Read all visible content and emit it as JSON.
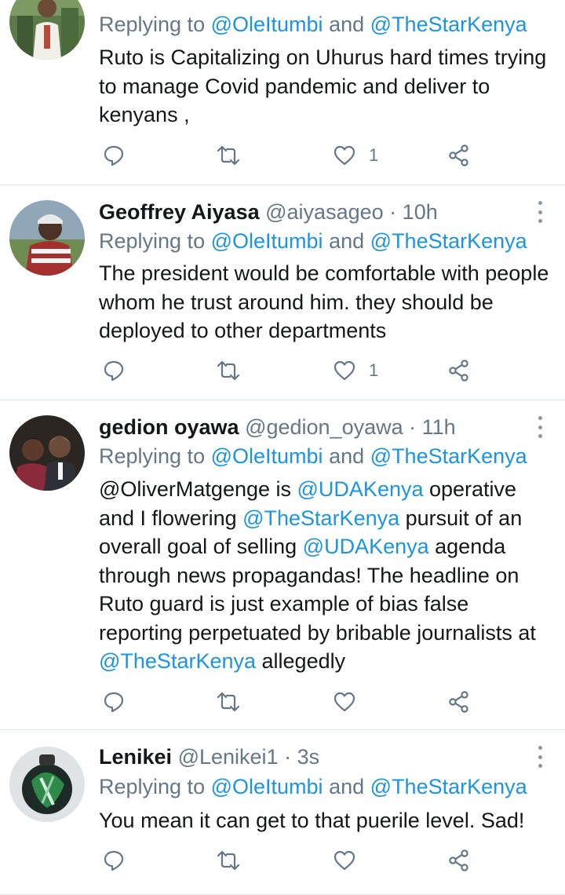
{
  "tweets": [
    {
      "name": "",
      "handle": "",
      "time": "",
      "replying_prefix": "Replying to",
      "replying_to": [
        "@OleItumbi",
        "@TheStarKenya"
      ],
      "replying_and": "and",
      "body": [
        {
          "text": "Ruto is Capitalizing on Uhurus hard times trying to manage Covid pandemic and deliver to kenyans ,",
          "mention": false
        }
      ],
      "likes": "1"
    },
    {
      "name": "Geoffrey Aiyasa",
      "handle": "@aiyasageo",
      "time": "10h",
      "replying_prefix": "Replying to",
      "replying_to": [
        "@OleItumbi",
        "@TheStarKenya"
      ],
      "replying_and": "and",
      "body": [
        {
          "text": "The president would be comfortable with people whom he trust around him. they should be deployed to other departments",
          "mention": false
        }
      ],
      "likes": "1"
    },
    {
      "name": "gedion oyawa",
      "handle": "@gedion_oyawa",
      "time": "11h",
      "replying_prefix": "Replying to",
      "replying_to": [
        "@OleItumbi",
        "@TheStarKenya"
      ],
      "replying_and": "and",
      "body": [
        {
          "text": "@OliverMatgenge is ",
          "mention": false
        },
        {
          "text": "@UDAKenya",
          "mention": true
        },
        {
          "text": " operative and I flowering ",
          "mention": false
        },
        {
          "text": "@TheStarKenya",
          "mention": true
        },
        {
          "text": " pursuit of an overall goal of selling ",
          "mention": false
        },
        {
          "text": "@UDAKenya",
          "mention": true
        },
        {
          "text": " agenda through news propagandas!  The headline on Ruto guard is just example of bias false reporting perpetuated by bribable journalists at ",
          "mention": false
        },
        {
          "text": "@TheStarKenya",
          "mention": true
        },
        {
          "text": " allegedly",
          "mention": false
        }
      ],
      "likes": ""
    },
    {
      "name": "Lenikei",
      "handle": "@Lenikei1",
      "time": "3s",
      "replying_prefix": "Replying to",
      "replying_to": [
        "@OleItumbi",
        "@TheStarKenya"
      ],
      "replying_and": "and",
      "body": [
        {
          "text": "You mean it can get to that puerile level. Sad!",
          "mention": false
        }
      ],
      "likes": ""
    }
  ],
  "icons": {
    "reply": "reply-icon",
    "retweet": "retweet-icon",
    "like": "heart-icon",
    "share": "share-icon",
    "more": "more-vertical-icon"
  },
  "colors": {
    "link": "#1b95e0",
    "secondary": "#657786",
    "icon": "#657786",
    "divider": "#e1e8ed"
  }
}
